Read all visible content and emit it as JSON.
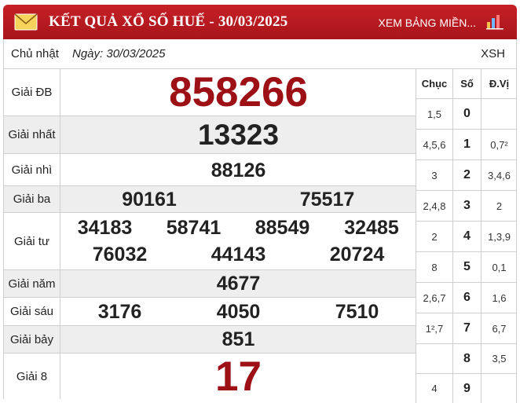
{
  "header": {
    "title": "KẾT QUẢ XỔ SỐ HUẾ - 30/03/2025",
    "region_link": "XEM BẢNG MIỀN..."
  },
  "info": {
    "day": "Chủ nhật",
    "date": "Ngày: 30/03/2025",
    "code": "XSH"
  },
  "prizes": {
    "db": {
      "label": "Giải ĐB",
      "numbers": [
        "858266"
      ]
    },
    "nhat": {
      "label": "Giải nhất",
      "numbers": [
        "13323"
      ]
    },
    "nhi": {
      "label": "Giải nhì",
      "numbers": [
        "88126"
      ]
    },
    "ba": {
      "label": "Giải ba",
      "numbers": [
        "90161",
        "75517"
      ]
    },
    "tu": {
      "label": "Giải tư",
      "numbers": [
        "34183",
        "58741",
        "88549",
        "32485",
        "76032",
        "44143",
        "20724"
      ]
    },
    "nam": {
      "label": "Giải năm",
      "numbers": [
        "4677"
      ]
    },
    "sau": {
      "label": "Giải sáu",
      "numbers": [
        "3176",
        "4050",
        "7510"
      ]
    },
    "bay": {
      "label": "Giải bảy",
      "numbers": [
        "851"
      ]
    },
    "tam": {
      "label": "Giải 8",
      "numbers": [
        "17"
      ]
    }
  },
  "loto": {
    "headers": [
      "Chục",
      "Số",
      "Đ.Vị"
    ],
    "rows": [
      {
        "chuc": "1,5",
        "so": "0",
        "dvi": ""
      },
      {
        "chuc": "4,5,6",
        "so": "1",
        "dvi": "0,7²"
      },
      {
        "chuc": "3",
        "so": "2",
        "dvi": "3,4,6"
      },
      {
        "chuc": "2,4,8",
        "so": "3",
        "dvi": "2"
      },
      {
        "chuc": "2",
        "so": "4",
        "dvi": "1,3,9"
      },
      {
        "chuc": "8",
        "so": "5",
        "dvi": "0,1"
      },
      {
        "chuc": "2,6,7",
        "so": "6",
        "dvi": "1,6"
      },
      {
        "chuc": "1²,7",
        "so": "7",
        "dvi": "6,7"
      },
      {
        "chuc": "",
        "so": "8",
        "dvi": "3,5"
      },
      {
        "chuc": "4",
        "so": "9",
        "dvi": ""
      }
    ]
  },
  "colors": {
    "header_red": "#b51a20",
    "special_prize": "#9c1016",
    "row_alt": "#eeeeee"
  },
  "icons": {
    "mail": "envelope-icon",
    "chart": "bar-chart-icon"
  }
}
